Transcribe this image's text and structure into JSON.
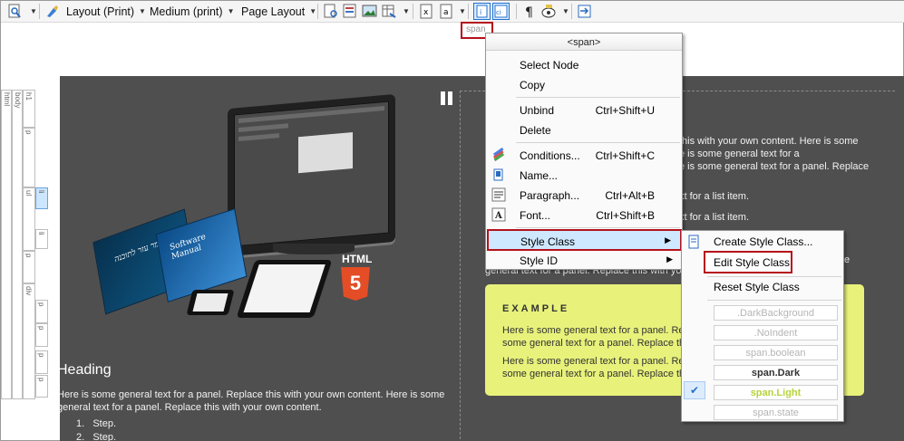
{
  "toolbar": {
    "layout_label": "Layout (Print)",
    "medium_label": "Medium (print)",
    "page_layout_label": "Page Layout"
  },
  "span_tag": "span",
  "left_tags": [
    "html",
    "body",
    "h1",
    "p",
    "ul",
    "li",
    "li",
    "p",
    "div",
    "p",
    "p",
    "p",
    "p"
  ],
  "editor": {
    "heading": "Heading",
    "body_line1": "Here is some general text for a panel. Replace this with your own content. Here is some",
    "body_line2": "general text for a panel. Replace this with your own content.",
    "steps": [
      "Step.",
      "Step."
    ],
    "book1_title": "סמר עזר לתוכנה",
    "book2_title": "Software Manual",
    "html5_label": "HTML",
    "html5_number": "5",
    "right_lines": [
      "this with your own content. Here is some",
      "e is some general text for a",
      "e is some general text for a panel. Replace",
      "xt for a list item.",
      "xt for a list item."
    ],
    "right_partial": "e",
    "right_under_line1": "e",
    "right_under_line2": "general text for a panel. Replace this with your own content."
  },
  "panel": {
    "title": "EXAMPLE",
    "p1_line1": "Here is some general text for a panel. Repl",
    "p1_line2": "some general text for a panel. Replace this",
    "p2_line1": "Here is some general text for a panel. Repl",
    "p2_line2": "some general text for a panel. Replace this"
  },
  "context_menu": {
    "header": "<span>",
    "items": [
      {
        "label": "Select Node",
        "shortcut": ""
      },
      {
        "label": "Copy",
        "shortcut": ""
      },
      {
        "label": "Unbind",
        "shortcut": "Ctrl+Shift+U"
      },
      {
        "label": "Delete",
        "shortcut": ""
      },
      {
        "label": "Conditions...",
        "shortcut": "Ctrl+Shift+C"
      },
      {
        "label": "Name...",
        "shortcut": ""
      },
      {
        "label": "Paragraph...",
        "shortcut": "Ctrl+Alt+B"
      },
      {
        "label": "Font...",
        "shortcut": "Ctrl+Shift+B"
      },
      {
        "label": "Style Class",
        "shortcut": ""
      },
      {
        "label": "Style ID",
        "shortcut": ""
      }
    ]
  },
  "submenu": {
    "create": "Create Style Class...",
    "edit": "Edit Style Class",
    "reset": "Reset Style Class",
    "classes": [
      ".DarkBackground",
      ".NoIndent",
      "span.boolean",
      "span.Dark",
      "span.Light",
      "span.state"
    ],
    "checked": "span.Light"
  },
  "colors": {
    "highlight_border": "#b5121b",
    "editor_background": "#4f4f4f",
    "panel_background": "#e8f27b",
    "menu_hover": "#cde8ff"
  }
}
